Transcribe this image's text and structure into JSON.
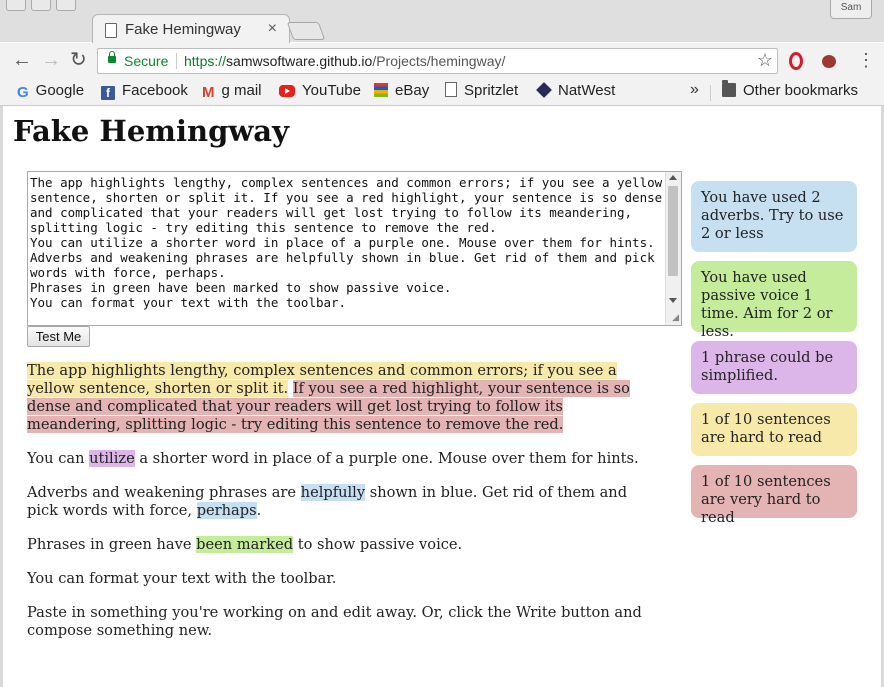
{
  "browser": {
    "tab_title": "Fake Hemingway",
    "tab_close": "×",
    "user_badge": "Sam",
    "secure_label": "Secure",
    "url_scheme": "https://",
    "url_host": "samwsoftware.github.io",
    "url_path": "/Projects/hemingway/",
    "bookmarks": [
      {
        "label": "Google",
        "icon": "google-icon"
      },
      {
        "label": "Facebook",
        "icon": "facebook-icon"
      },
      {
        "label": "g mail",
        "icon": "gmail-icon"
      },
      {
        "label": "YouTube",
        "icon": "youtube-icon"
      },
      {
        "label": "eBay",
        "icon": "ebay-icon"
      },
      {
        "label": "Spritzlet",
        "icon": "page-icon"
      },
      {
        "label": "NatWest",
        "icon": "natwest-icon"
      }
    ],
    "overflow_chevron": "»",
    "other_bookmarks": "Other bookmarks"
  },
  "page": {
    "title": "Fake Hemingway",
    "editor_text": "The app highlights lengthy, complex sentences and common errors; if you see a yellow sentence, shorten or split it. If you see a red highlight, your sentence is so dense and complicated that your readers will get lost trying to follow its meandering, splitting logic - try editing this sentence to remove the red.\nYou can utilize a shorter word in place of a purple one. Mouse over them for hints.\nAdverbs and weakening phrases are helpfully shown in blue. Get rid of them and pick words with force, perhaps.\nPhrases in green have been marked to show passive voice.\nYou can format your text with the toolbar.",
    "test_button": "Test Me"
  },
  "output": {
    "p1_yellow": "The app highlights lengthy, complex sentences and common errors; if you see a yellow sentence, shorten or split it.",
    "p1_red": "If you see a red highlight, your sentence is so dense and complicated that your readers will get lost trying to follow its meandering, splitting logic - try editing this sentence to remove the red.",
    "p2_before": "You can ",
    "p2_purple": "utilize",
    "p2_after": " a shorter word in place of a purple one. Mouse over them for hints.",
    "p3_before": "Adverbs and weakening phrases are ",
    "p3_blue1": "helpfully",
    "p3_mid": " shown in blue. Get rid of them and pick words with force, ",
    "p3_blue2": "perhaps",
    "p3_after": ".",
    "p4_before": "Phrases in green have ",
    "p4_green": "been marked",
    "p4_after": " to show passive voice.",
    "p5": "You can format your text with the toolbar.",
    "p6": "Paste in something you're working on and edit away. Or, click the Write button and compose something new."
  },
  "sidebar": {
    "adverbs": "You have used 2 adverbs. Try to use 2 or less",
    "passive": "You have used passive voice 1 time. Aim for 2 or less.",
    "simpler": "1 phrase could be simplified.",
    "hard": "1 of 10 sentences are hard to read",
    "very_hard": "1 of 10 sentences are very hard to read"
  },
  "colors": {
    "yellow": "#f7e9a9",
    "red": "#e4b3b3",
    "purple": "#dcb6e8",
    "blue": "#c6dff1",
    "green": "#c4ec9b",
    "secure_green": "#0a8a2f"
  }
}
